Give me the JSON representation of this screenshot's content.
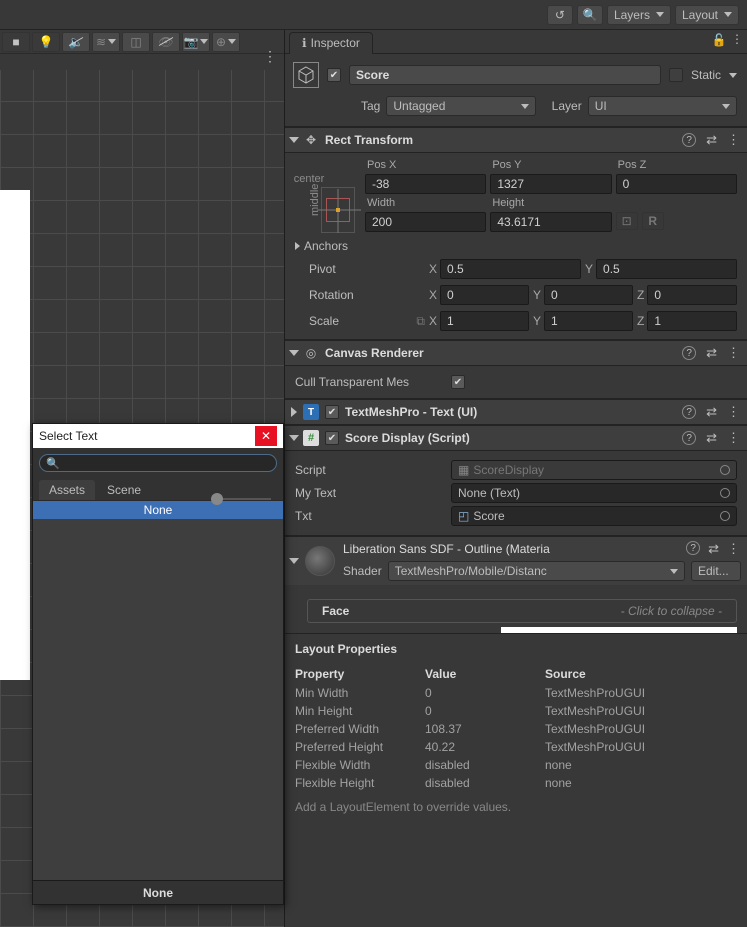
{
  "top_toolbar": {
    "layers_label": "Layers",
    "layout_label": "Layout"
  },
  "inspector": {
    "tab": "Inspector",
    "go_name": "Score",
    "static_label": "Static",
    "tag_label": "Tag",
    "tag_value": "Untagged",
    "layer_label": "Layer",
    "layer_value": "UI"
  },
  "rect_transform": {
    "title": "Rect Transform",
    "anchor_center": "center",
    "anchor_middle": "middle",
    "posx_label": "Pos X",
    "posx": "-38",
    "posy_label": "Pos Y",
    "posy": "1327",
    "posz_label": "Pos Z",
    "posz": "0",
    "width_label": "Width",
    "width": "200",
    "height_label": "Height",
    "height": "43.6171",
    "anchors_label": "Anchors",
    "pivot_label": "Pivot",
    "pivot_x": "0.5",
    "pivot_y": "0.5",
    "rotation_label": "Rotation",
    "rx": "0",
    "ry": "0",
    "rz": "0",
    "scale_label": "Scale",
    "sx": "1",
    "sy": "1",
    "sz": "1"
  },
  "canvas_renderer": {
    "title": "Canvas Renderer",
    "cull_label": "Cull Transparent Mes"
  },
  "tmp_text": {
    "title": "TextMeshPro - Text (UI)"
  },
  "score_display": {
    "title": "Score Display (Script)",
    "script_label": "Script",
    "script_value": "ScoreDisplay",
    "mytext_label": "My Text",
    "mytext_value": "None (Text)",
    "txt_label": "Txt",
    "txt_value": "Score"
  },
  "material": {
    "title": "Liberation Sans SDF - Outline (Materia",
    "shader_label": "Shader",
    "shader_value": "TextMeshPro/Mobile/Distanc",
    "edit_btn": "Edit...",
    "face_label": "Face",
    "face_hint": "- Click to collapse -"
  },
  "layout_props": {
    "title": "Layout Properties",
    "h_property": "Property",
    "h_value": "Value",
    "h_source": "Source",
    "rows": [
      {
        "prop": "Min Width",
        "val": "0",
        "src": "TextMeshProUGUI"
      },
      {
        "prop": "Min Height",
        "val": "0",
        "src": "TextMeshProUGUI"
      },
      {
        "prop": "Preferred Width",
        "val": "108.37",
        "src": "TextMeshProUGUI"
      },
      {
        "prop": "Preferred Height",
        "val": "40.22",
        "src": "TextMeshProUGUI"
      },
      {
        "prop": "Flexible Width",
        "val": "disabled",
        "src": "none"
      },
      {
        "prop": "Flexible Height",
        "val": "disabled",
        "src": "none"
      }
    ],
    "hint": "Add a LayoutElement to override values."
  },
  "popup": {
    "title": "Select Text",
    "search_placeholder": "",
    "tab_assets": "Assets",
    "tab_scene": "Scene",
    "none_item": "None",
    "status": "None"
  }
}
